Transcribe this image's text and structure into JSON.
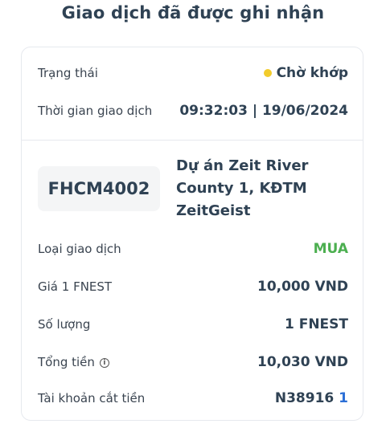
{
  "header": {
    "title": "Giao dịch đã được ghi nhận"
  },
  "status": {
    "label": "Trạng thái",
    "value": "Chờ khớp",
    "dot_color": "#f2cc2c"
  },
  "time": {
    "label": "Thời gian giao dịch",
    "value": "09:32:03 | 19/06/2024"
  },
  "asset": {
    "code": "FHCM4002",
    "name_lines": [
      "Dự án Zeit River",
      "County 1, KĐTM",
      "ZeitGeist"
    ]
  },
  "details": {
    "type": {
      "label": "Loại giao dịch",
      "value": "MUA",
      "color": "#4caf50"
    },
    "price": {
      "label": "Giá 1 FNEST",
      "value": "10,000 VND"
    },
    "quantity": {
      "label": "Số lượng",
      "value": "1 FNEST"
    },
    "total": {
      "label": "Tổng tiền",
      "value": "10,030 VND",
      "icon": "info-icon"
    },
    "account": {
      "label": "Tài khoản cắt tiền",
      "value_main": "N38916",
      "value_suffix": "1"
    }
  }
}
